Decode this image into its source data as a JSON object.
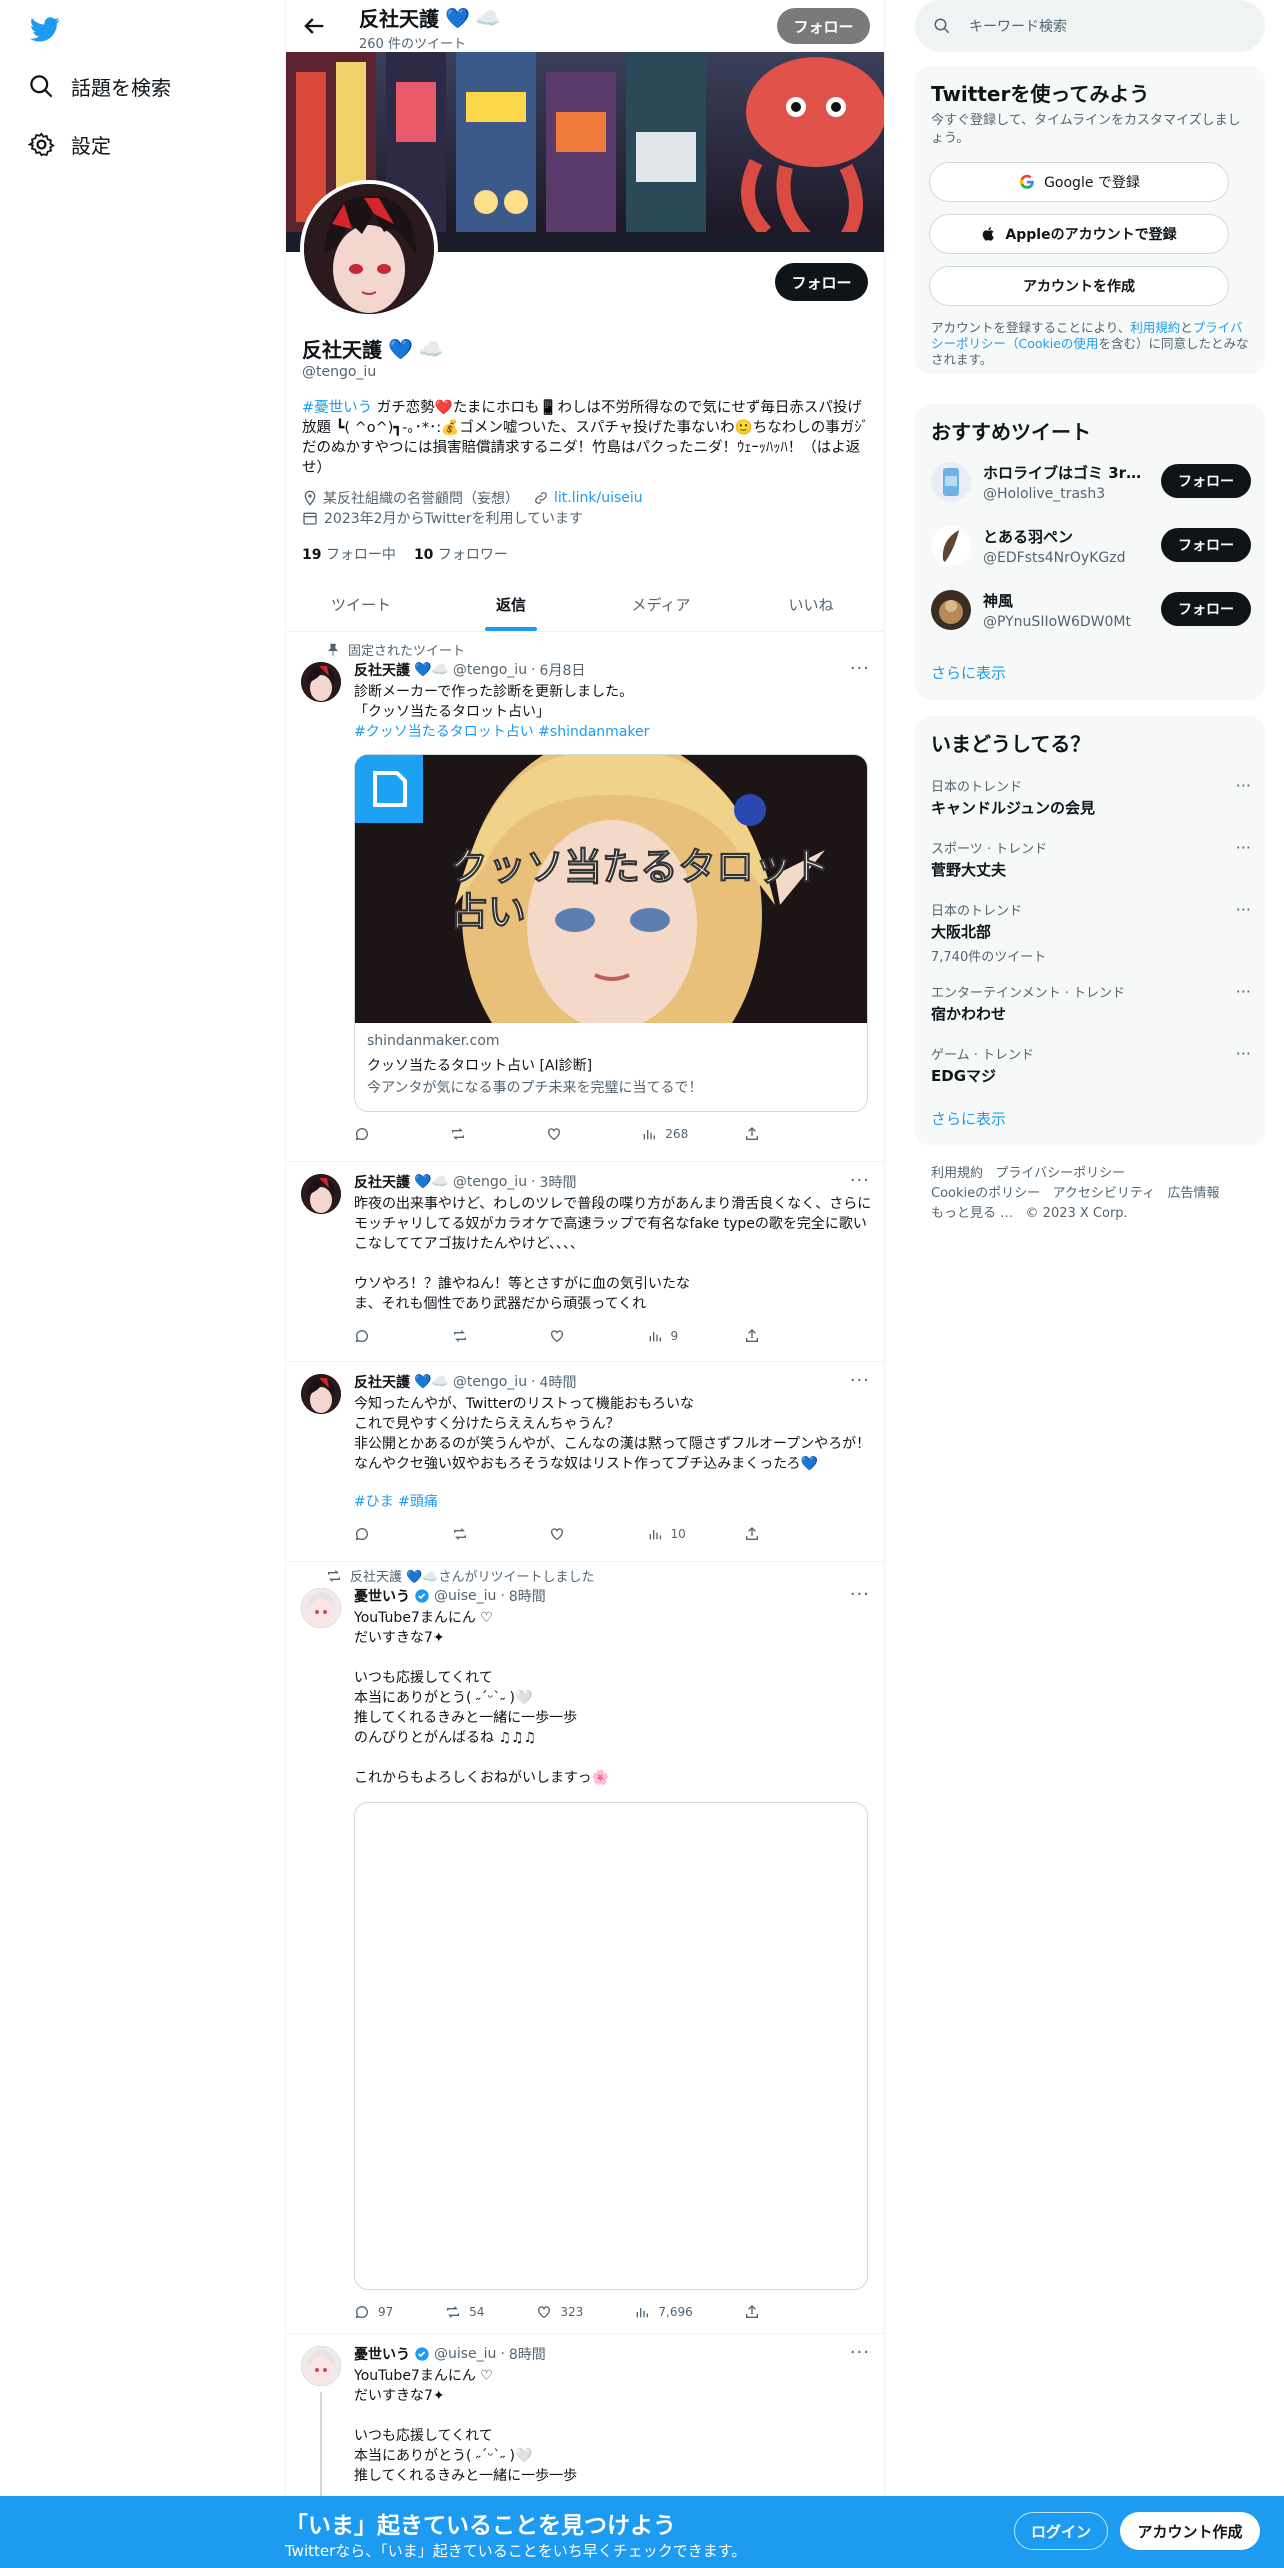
{
  "sidebar": {
    "items": [
      {
        "label": "話題を検索",
        "icon": "search-icon"
      },
      {
        "label": "設定",
        "icon": "gear-icon"
      }
    ]
  },
  "header": {
    "name": "反社天護",
    "tweet_count": "260 件のツイート",
    "follow": "フォロー"
  },
  "profile": {
    "name": "反社天護",
    "handle": "@tengo_iu",
    "follow": "フォロー",
    "bio_link": "#憂世いう",
    "bio": " ガチ恋勢❤️たまにホロも📱わしは不労所得なので気にせず毎日赤スパ投げ放題 ┗( ^o^)┓-｡･*･:💰ゴメン嘘ついた、スパチャ投げた事ないわ🙂ちなわしの事ガｼﾞだのぬかすやつには損害賠償請求するニダ！竹島はパクったニダ！ｳｪｰｯﾊｯﾊ！（はよ返せ）",
    "location": "某反社組織の名誉顧問（妄想）",
    "url": "lit.link/uiseiu",
    "joined": "2023年2月からTwitterを利用しています",
    "following_count": "19",
    "following_label": "フォロー中",
    "followers_count": "10",
    "followers_label": "フォロワー"
  },
  "tabs": [
    "ツイート",
    "返信",
    "メディア",
    "いいね"
  ],
  "tweets": [
    {
      "pinned": "固定されたツイート",
      "name": "反社天護",
      "handle": "@tengo_iu",
      "time": "6月8日",
      "text": "診断メーカーで作った診断を更新しました。\n「クッソ当たるタロット占い」",
      "tags": "#クッソ当たるタロット占い #shindanmaker",
      "card_domain": "shindanmaker.com",
      "card_title": "クッソ当たるタロット占い [AI診断]",
      "card_desc": "今アンタが気になる事のプチ未来を完璧に当てるで！",
      "card_overlay": "クッソ当たるタロット\n占い",
      "views": "268"
    },
    {
      "name": "反社天護",
      "handle": "@tengo_iu",
      "time": "3時間",
      "text": "昨夜の出来事やけど、わしのツレで普段の喋り方があんまり滑舌良くなく、さらにモッチャリしてる奴がカラオケで高速ラップで有名なfake typeの歌を完全に歌いこなしててアゴ抜けたんやけど、、、、\n\nウソやろ！？誰やねん！等とさすがに血の気引いたな\nま、それも個性であり武器だから頑張ってくれ",
      "views": "9"
    },
    {
      "name": "反社天護",
      "handle": "@tengo_iu",
      "time": "4時間",
      "text": "今知ったんやが、Twitterのリストって機能おもろいな\nこれで見やすく分けたらええんちゃうん？\n非公開とかあるのが笑うんやが、こんなの漢は黙って隠さずフルオープンやろが！\nなんやクセ強い奴やおもろそうな奴はリスト作ってブチ込みまくったろ💙",
      "tags": "#ひま #頭痛",
      "views": "10"
    },
    {
      "retweet": "反社天護 💙☁️さんがリツイートしました",
      "name": "憂世いう",
      "handle": "@uise_iu",
      "time": "8時間",
      "text": "YouTube7まんにん ♡\nだいすきな7✦\n\nいつも応援してくれて\n本当にありがとう( ˶ˊᵕˋ˶ )🤍\n推してくれるきみと一緒に一歩一歩\nのんびりとがんばるね ♫♫♫\n\nこれからもよろしくおねがいしますっ🌸",
      "replies": "97",
      "retweets": "54",
      "likes": "323",
      "views": "7,696"
    },
    {
      "name": "憂世いう",
      "handle": "@uise_iu",
      "time": "8時間",
      "text": "YouTube7まんにん ♡\nだいすきな7✦\n\nいつも応援してくれて\n本当にありがとう( ˶ˊᵕˋ˶ )🤍\n推してくれるきみと一緒に一歩一歩"
    }
  ],
  "right": {
    "search_placeholder": "キーワード検索",
    "signup": {
      "title": "Twitterを使ってみよう",
      "desc": "今すぐ登録して、タイムラインをカスタマイズしましょう。",
      "google": "Google で登録",
      "apple": "Appleのアカウントで登録",
      "create": "アカウントを作成",
      "legal_pre": "アカウントを登録することにより、",
      "legal_link1": "利用規約",
      "legal_mid": "と",
      "legal_link2": "プライバシーポリシー（Cookieの使用",
      "legal_post": "を含む）に同意したとみなされます。"
    },
    "recommend": {
      "title": "おすすめツイート",
      "items": [
        {
          "name": "ホロライブはゴミ 3rd...",
          "handle": "@Hololive_trash3"
        },
        {
          "name": "とある羽ペン",
          "handle": "@EDFsts4NrOyKGzd"
        },
        {
          "name": "神風",
          "handle": "@PYnuSIIoW6DW0Mt"
        }
      ],
      "follow": "フォロー",
      "more": "さらに表示"
    },
    "trends": {
      "title": "いまどうしてる？",
      "items": [
        {
          "cat": "日本のトレンド",
          "name": "キャンドルジュンの会見"
        },
        {
          "cat": "スポーツ · トレンド",
          "name": "菅野大丈夫"
        },
        {
          "cat": "日本のトレンド",
          "name": "大阪北部",
          "count": "7,740件のツイート"
        },
        {
          "cat": "エンターテインメント · トレンド",
          "name": "宿かわわせ"
        },
        {
          "cat": "ゲーム · トレンド",
          "name": "EDGマジ"
        }
      ],
      "more": "さらに表示"
    },
    "footer": {
      "l1": "利用規約",
      "l2": "プライバシーポリシー",
      "l3": "Cookieのポリシー",
      "l4": "アクセシビリティ",
      "l5": "広告情報",
      "l6": "もっと見る …",
      "l7": "© 2023 X Corp."
    }
  },
  "bottom": {
    "title": "「いま」起きていることを見つけよう",
    "sub": "Twitterなら、「いま」起きていることをいち早くチェックできます。",
    "login": "ログイン",
    "signup": "アカウント作成"
  },
  "colors": {
    "accent": "#1d9bf0",
    "text": "#0f1419",
    "muted": "#536471"
  }
}
